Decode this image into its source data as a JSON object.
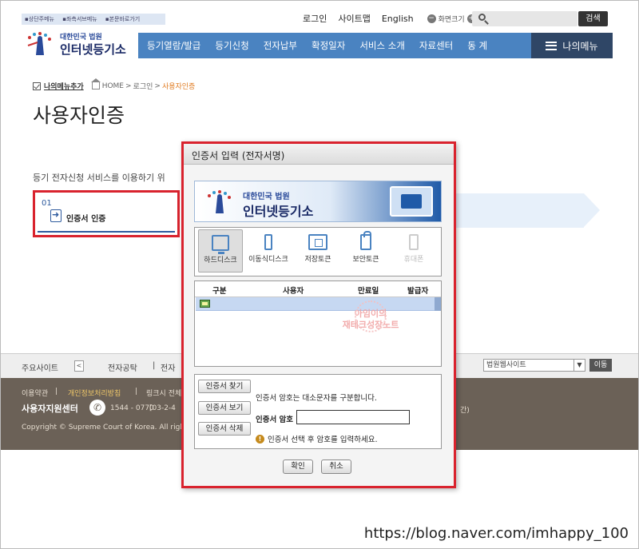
{
  "skip_links": [
    "상단주메뉴",
    "좌측서브메뉴",
    "본문바로가기"
  ],
  "util": {
    "login": "로그인",
    "sitemap": "사이트맵",
    "english": "English",
    "font_size": "화면크기",
    "minus": "−",
    "plus": "+",
    "search_button": "검색"
  },
  "logo": {
    "line1": "대한민국 법원",
    "line2": "인터넷등기소"
  },
  "nav": {
    "items": [
      "등기열람/발급",
      "등기신청",
      "전자납부",
      "확정일자",
      "서비스 소개",
      "자료센터",
      "동 계"
    ],
    "my_menu": "나의메뉴"
  },
  "breadcrumb": {
    "add_my_menu": "나의메뉴추가",
    "home": "HOME",
    "sep1": ">",
    "login": "로그인",
    "sep2": ">",
    "current": "사용자인증"
  },
  "page_title": "사용자인증",
  "description": "등기 전자신청 서비스를 이용하기 위",
  "step": {
    "number": "01",
    "label": "인증서 인증"
  },
  "footer": {
    "major_sites": "주요사이트",
    "prev": "<",
    "site1": "전자공탁",
    "sep": "|",
    "site2": "전자",
    "court_site_select": "법원웹사이트",
    "go_button": "이동",
    "terms": "이용약관",
    "privacy": "개인정보처리방침",
    "link_prefix": "링크시 전체",
    "support_center": "사용자지원센터",
    "phone": "1544 - 0770",
    "hours": "[03-2-4",
    "hours_suffix": "간)",
    "copyright": "Copyright © Supreme Court of Korea. All rights"
  },
  "dialog": {
    "title": "인증서 입력 (전자서명)",
    "banner_line1": "대한민국 법원",
    "banner_line2": "인터넷등기소",
    "media": [
      {
        "label": "하드디스크",
        "icon": "hard-disk-icon",
        "selected": true,
        "enabled": true
      },
      {
        "label": "이동식디스크",
        "icon": "usb-drive-icon",
        "selected": false,
        "enabled": true
      },
      {
        "label": "저장토큰",
        "icon": "storage-token-icon",
        "selected": false,
        "enabled": true
      },
      {
        "label": "보안토큰",
        "icon": "security-token-icon",
        "selected": false,
        "enabled": true
      },
      {
        "label": "휴대폰",
        "icon": "mobile-phone-icon",
        "selected": false,
        "enabled": false
      }
    ],
    "columns": [
      "구분",
      "사용자",
      "만료일",
      "발급자"
    ],
    "watermark_line1": "아임이의",
    "watermark_line2": "재테크성장노트",
    "buttons": {
      "find": "인증서 찾기",
      "view": "인증서 보기",
      "delete": "인증서 삭제"
    },
    "case_note": "인증서 암호는 대소문자를 구분합니다.",
    "password_label": "인증서 암호",
    "password_value": "",
    "warning": "인증서 선택 후 암호를 입력하세요.",
    "ok": "확인",
    "cancel": "취소"
  },
  "credit": "https://blog.naver.com/imhappy_100",
  "colors": {
    "nav_blue": "#4a83c1",
    "mymenu_navy": "#2f4666",
    "highlight_red": "#d9232e",
    "footer_brown": "#6b6157"
  }
}
